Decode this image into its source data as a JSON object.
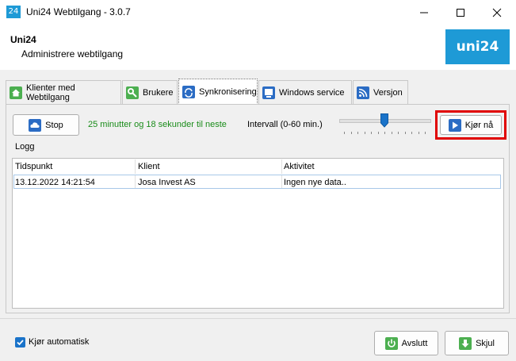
{
  "window": {
    "app_icon_text": "24",
    "title": "Uni24 Webtilgang - 3.0.7"
  },
  "header": {
    "title": "Uni24",
    "subtitle": "Administrere webtilgang",
    "logo_text": "uni24"
  },
  "tabs": [
    {
      "label": "Klienter med Webtilgang",
      "icon": "home-icon"
    },
    {
      "label": "Brukere",
      "icon": "key-icon"
    },
    {
      "label": "Synkronisering",
      "icon": "sync-icon"
    },
    {
      "label": "Windows service",
      "icon": "service-icon"
    },
    {
      "label": "Versjon",
      "icon": "rss-icon"
    }
  ],
  "active_tab": "Synkronisering",
  "sync": {
    "stop_label": "Stop",
    "status_text": "25 minutter og 18 sekunder til neste",
    "interval_label": "Intervall (0-60 min.)",
    "interval_value_fraction": 0.5,
    "run_now_label": "Kjør nå",
    "log_label": "Logg"
  },
  "log_table": {
    "columns": [
      "Tidspunkt",
      "Klient",
      "Aktivitet"
    ],
    "rows": [
      [
        "13.12.2022 14:21:54",
        "Josa Invest AS",
        "Ingen nye data.."
      ]
    ]
  },
  "footer": {
    "auto_run_label": "Kjør automatisk",
    "auto_run_checked": true,
    "exit_label": "Avslutt",
    "hide_label": "Skjul"
  },
  "colors": {
    "brand": "#1e9ad6",
    "status_green": "#1a8c1a",
    "highlight_red": "#e00000"
  }
}
